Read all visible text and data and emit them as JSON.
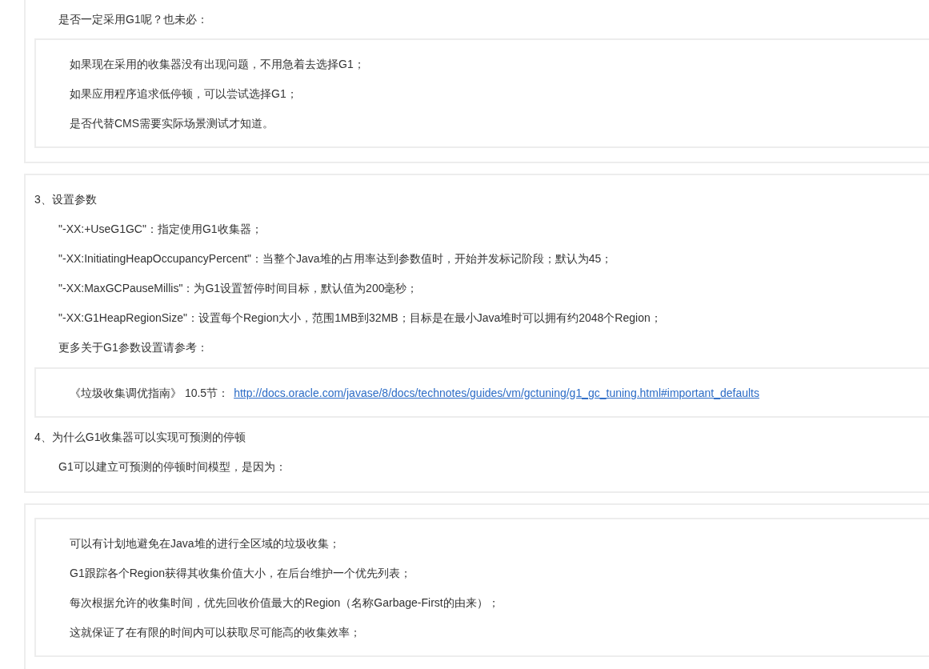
{
  "panels": [
    {
      "items": [
        {
          "kind": "para",
          "text": "是否一定采用G1呢？也未必："
        },
        {
          "kind": "quote",
          "lines": [
            {
              "text": "如果现在采用的收集器没有出现问题，不用急着去选择G1；"
            },
            {
              "text": "如果应用程序追求低停顿，可以尝试选择G1；"
            },
            {
              "text": "是否代替CMS需要实际场景测试才知道。"
            }
          ]
        }
      ]
    },
    {
      "items": [
        {
          "kind": "heading",
          "text": "3、设置参数"
        },
        {
          "kind": "para",
          "text": "\"-XX:+UseG1GC\"：指定使用G1收集器；"
        },
        {
          "kind": "para",
          "text": "\"-XX:InitiatingHeapOccupancyPercent\"：当整个Java堆的占用率达到参数值时，开始并发标记阶段；默认为45；"
        },
        {
          "kind": "para",
          "text": "\"-XX:MaxGCPauseMillis\"：为G1设置暂停时间目标，默认值为200毫秒；"
        },
        {
          "kind": "para",
          "text": "\"-XX:G1HeapRegionSize\"：设置每个Region大小，范围1MB到32MB；目标是在最小Java堆时可以拥有约2048个Region；"
        },
        {
          "kind": "para",
          "text": "更多关于G1参数设置请参考："
        },
        {
          "kind": "quote",
          "lines": [
            {
              "text": "《垃圾收集调优指南》 10.5节：",
              "link": "http://docs.oracle.com/javase/8/docs/technotes/guides/vm/gctuning/g1_gc_tuning.html#important_defaults"
            }
          ]
        },
        {
          "kind": "heading",
          "text": "4、为什么G1收集器可以实现可预测的停顿"
        },
        {
          "kind": "para",
          "text": "G1可以建立可预测的停顿时间模型，是因为："
        }
      ]
    },
    {
      "items": [
        {
          "kind": "quote",
          "lines": [
            {
              "text": "可以有计划地避免在Java堆的进行全区域的垃圾收集；"
            },
            {
              "text": "G1跟踪各个Region获得其收集价值大小，在后台维护一个优先列表；"
            },
            {
              "text": "每次根据允许的收集时间，优先回收价值最大的Region（名称Garbage-First的由来）；"
            },
            {
              "text": "这就保证了在有限的时间内可以获取尽可能高的收集效率；"
            }
          ]
        }
      ]
    }
  ]
}
